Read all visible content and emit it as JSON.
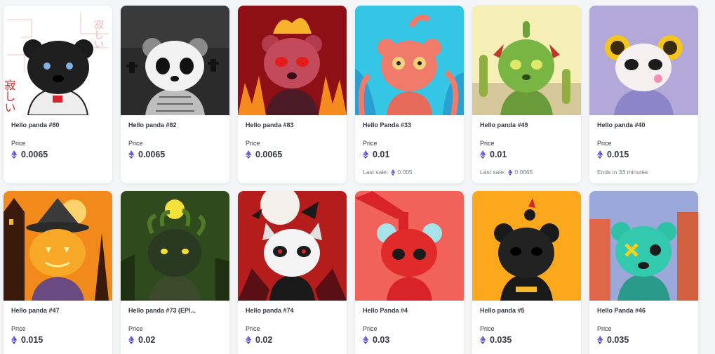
{
  "cards": [
    {
      "name": "Hello panda #80",
      "price_label": "Price",
      "price": "0.0065",
      "extra_prefix": "",
      "extra_value": "",
      "art": "astronaut-panda",
      "colors": {
        "bg": "#ffffff"
      }
    },
    {
      "name": "Hello panda #82",
      "price_label": "Price",
      "price": "0.0065",
      "extra_prefix": "",
      "extra_value": "",
      "art": "skeleton-panda",
      "colors": {
        "bg": "#2b2b2b"
      }
    },
    {
      "name": "Hello panda #83",
      "price_label": "Price",
      "price": "0.0065",
      "extra_prefix": "",
      "extra_value": "",
      "art": "fire-panda",
      "colors": {
        "bg": "#a3141a"
      }
    },
    {
      "name": "Hello Panda #33",
      "price_label": "Price",
      "price": "0.01",
      "extra_prefix": "Last sale:",
      "extra_value": "0.005",
      "art": "octopus-panda",
      "colors": {
        "bg": "#35c6e6"
      }
    },
    {
      "name": "Hello panda #49",
      "price_label": "Price",
      "price": "0.01",
      "extra_prefix": "Last sale:",
      "extra_value": "0.0065",
      "art": "cactus-panda",
      "colors": {
        "bg": "#f5efb6"
      }
    },
    {
      "name": "Hello panda #40",
      "price_label": "Price",
      "price": "0.015",
      "extra_prefix": "Ends in 33 minutes",
      "extra_value": "",
      "art": "sunflower-panda",
      "colors": {
        "bg": "#b2a9d8"
      }
    },
    {
      "name": "Hello panda #47",
      "price_label": "Price",
      "price": "0.015",
      "extra_prefix": "",
      "extra_value": "",
      "art": "pumpkin-panda",
      "colors": {
        "bg": "#f18a1a"
      }
    },
    {
      "name": "Hello panda #73 (EPI...",
      "price_label": "Price",
      "price": "0.02",
      "extra_prefix": "",
      "extra_value": "",
      "art": "medusa-panda",
      "colors": {
        "bg": "#2f4a1c"
      }
    },
    {
      "name": "Hello panda #74",
      "price_label": "Price",
      "price": "0.02",
      "extra_prefix": "",
      "extra_value": "",
      "art": "vampire-panda",
      "colors": {
        "bg": "#b51d1d"
      }
    },
    {
      "name": "Hello Panda #4",
      "price_label": "Price",
      "price": "0.03",
      "extra_prefix": "",
      "extra_value": "",
      "art": "ketchup-panda",
      "colors": {
        "bg": "#f0625a"
      }
    },
    {
      "name": "Hello panda #5",
      "price_label": "Price",
      "price": "0.035",
      "extra_prefix": "",
      "extra_value": "",
      "art": "bomb-panda",
      "colors": {
        "bg": "#fba81c"
      }
    },
    {
      "name": "Hello Panda #46",
      "price_label": "Price",
      "price": "0.035",
      "extra_prefix": "",
      "extra_value": "",
      "art": "zombie-panda",
      "colors": {
        "bg": "#9aa9d9"
      }
    }
  ],
  "art_text": {
    "astronaut_kanji": "寂しい"
  },
  "currency_icon": "ethereum-icon",
  "colors": {
    "eth_top": "#8a72e6",
    "eth_bottom": "#4e3bb0",
    "text": "#353840",
    "muted": "#707a83"
  }
}
